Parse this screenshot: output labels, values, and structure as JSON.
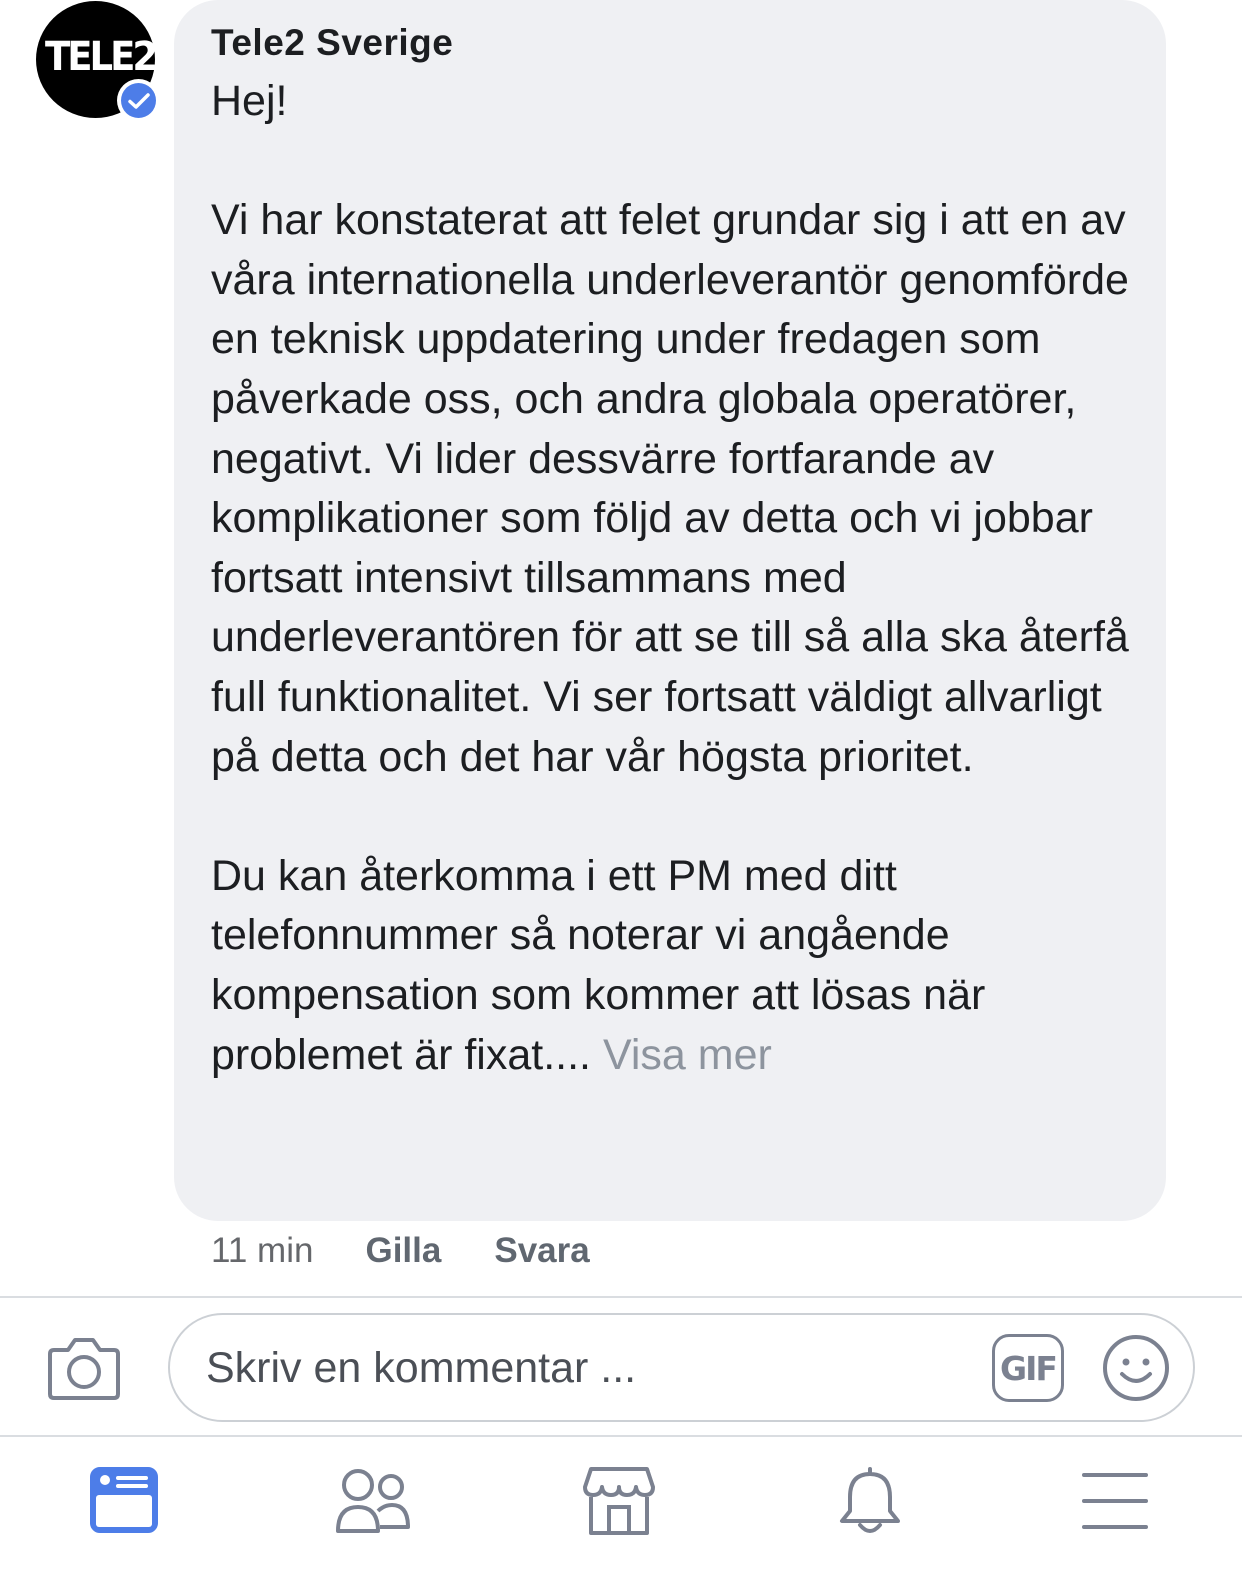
{
  "comment": {
    "author": "Tele2 Sverige",
    "avatar_logo": "TELE2",
    "paragraphs": [
      "Hej!",
      "Vi har konstaterat att felet grundar sig i att en av våra internationella underleverantör genomförde en teknisk uppdatering under fredagen som påverkade oss, och andra globala operatörer, negativt.  Vi lider dessvärre fortfarande av komplikationer som följd av detta och vi jobbar fortsatt intensivt tillsammans med underleverantören för att se till så alla ska återfå full funktionalitet. Vi ser fortsatt väldigt allvarligt på detta och det har vår högsta prioritet."
    ],
    "last_paragraph": "Du kan återkomma i ett PM med ditt telefonnummer så noterar vi angående kompensation som kommer att lösas när problemet är fixat....",
    "see_more": "Visa mer",
    "time": "11 min",
    "like_label": "Gilla",
    "reply_label": "Svara",
    "verified_icon": "verified-check-icon"
  },
  "composer": {
    "placeholder": "Skriv en kommentar ...",
    "value": "",
    "gif_label": "GIF",
    "camera_icon": "camera-icon",
    "emoji_icon": "smiley-icon"
  },
  "tabbar": {
    "items": [
      {
        "name": "news-feed",
        "icon": "news-feed-icon",
        "active": true
      },
      {
        "name": "friends",
        "icon": "friends-icon",
        "active": false
      },
      {
        "name": "marketplace",
        "icon": "marketplace-icon",
        "active": false
      },
      {
        "name": "notifications",
        "icon": "bell-icon",
        "active": false
      },
      {
        "name": "menu",
        "icon": "hamburger-menu-icon",
        "active": false
      }
    ]
  },
  "colors": {
    "bubble_bg": "#eff0f3",
    "text": "#1c1e21",
    "muted": "#8d949e",
    "accent_blue": "#4d7de8",
    "icon_gray": "#7b8190"
  }
}
